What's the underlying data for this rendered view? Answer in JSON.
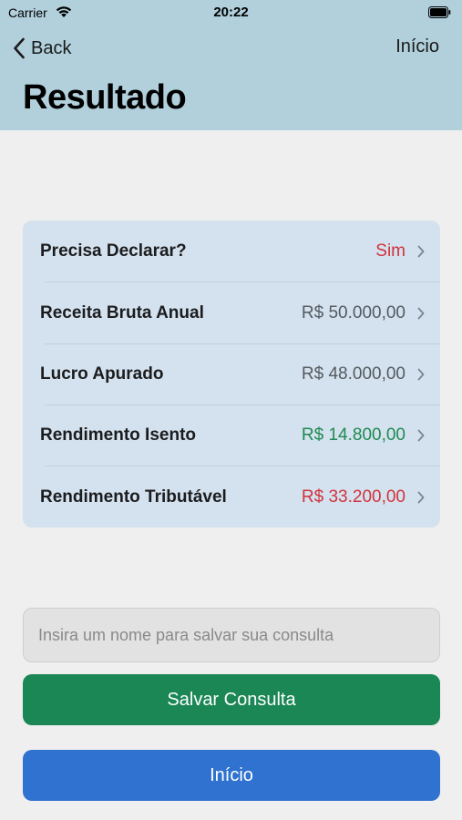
{
  "status_bar": {
    "carrier": "Carrier",
    "time": "20:22"
  },
  "nav": {
    "back_label": "Back",
    "right_label": "Início"
  },
  "page": {
    "title": "Resultado"
  },
  "results": [
    {
      "label": "Precisa Declarar?",
      "value": "Sim",
      "color": "#d2323c"
    },
    {
      "label": "Receita Bruta Anual",
      "value": "R$ 50.000,00",
      "color": "#555a60"
    },
    {
      "label": "Lucro Apurado",
      "value": "R$ 48.000,00",
      "color": "#555a60"
    },
    {
      "label": "Rendimento Isento",
      "value": "R$ 14.800,00",
      "color": "#1f8a52"
    },
    {
      "label": "Rendimento Tributável",
      "value": "R$ 33.200,00",
      "color": "#d2323c"
    }
  ],
  "save_form": {
    "name_value": "",
    "name_placeholder": "Insira um nome para salvar sua consulta",
    "save_label": "Salvar Consulta"
  },
  "home_button": {
    "label": "Início"
  },
  "icons": [
    "wifi-icon",
    "battery-icon",
    "chevron-left-icon",
    "chevron-right-icon"
  ]
}
